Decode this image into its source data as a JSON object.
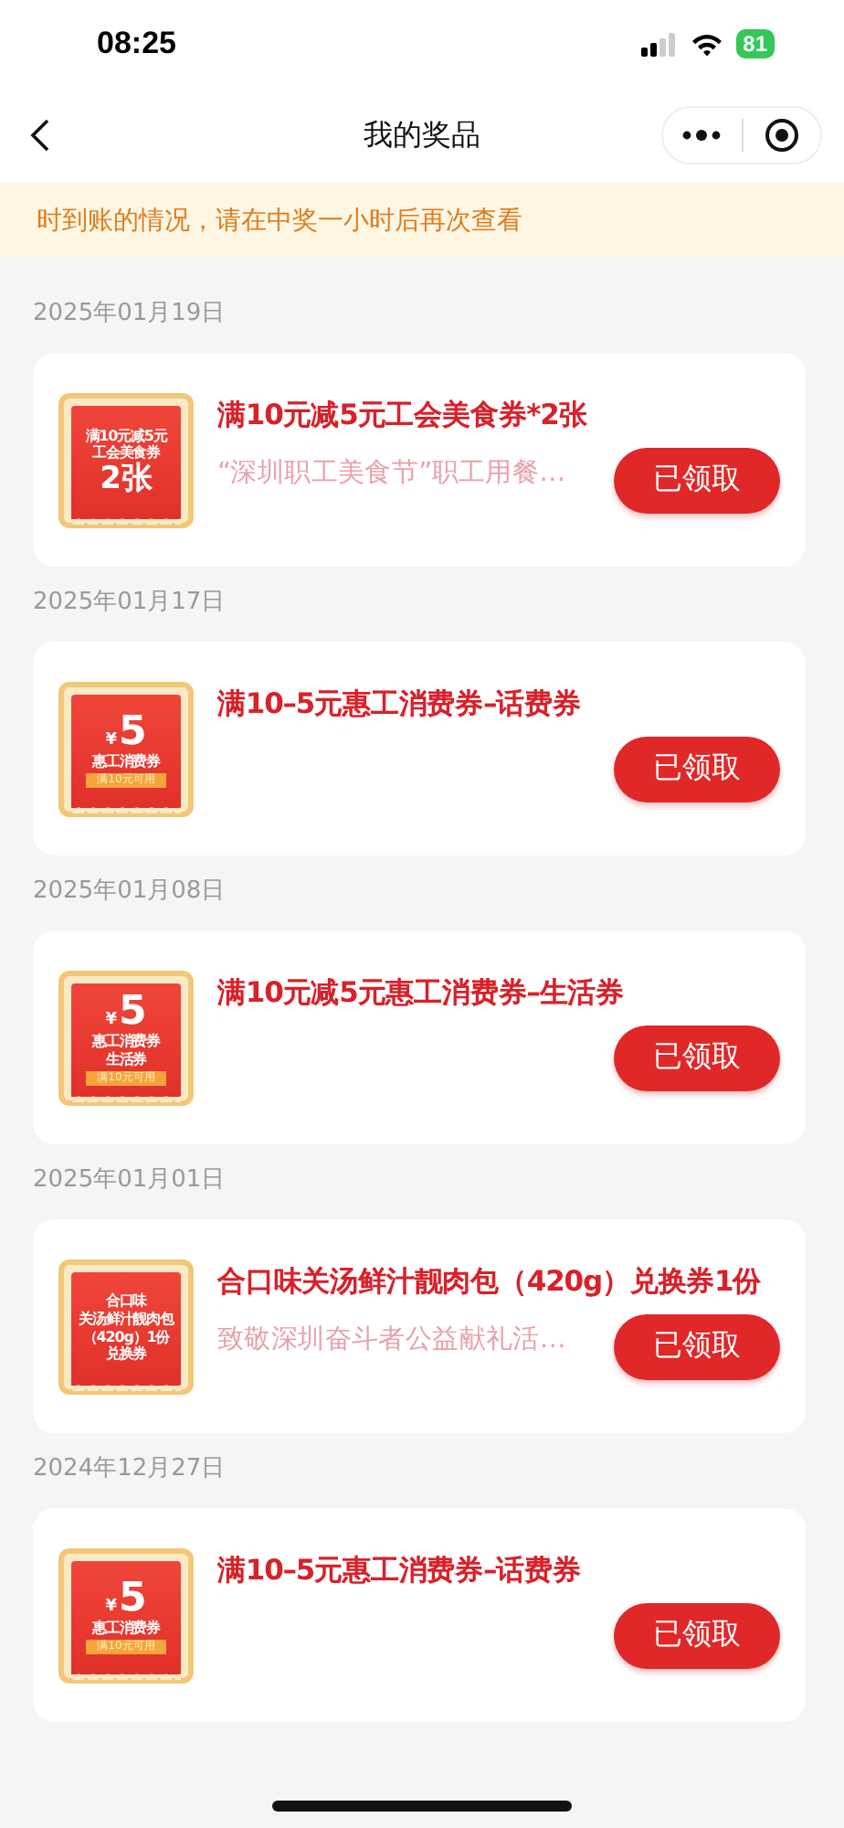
{
  "status_bar": {
    "time": "08:25",
    "battery": "81"
  },
  "nav": {
    "title": "我的奖品"
  },
  "notice": "时到账的情况，请在中奖一小时后再次查看",
  "groups": [
    {
      "date": "2025年01月19日",
      "prize": {
        "thumb": [
          {
            "kind": "small",
            "text": "满10元减5元"
          },
          {
            "kind": "small",
            "text": "工会美食券"
          },
          {
            "kind": "large",
            "text": "2张"
          }
        ],
        "title": "满10元减5元工会美食券*2张",
        "subtitle": "“深圳职工美食节”职工用餐…",
        "button": "已领取"
      }
    },
    {
      "date": "2025年01月17日",
      "prize": {
        "thumb": [
          {
            "kind": "price",
            "currency": "¥",
            "text": "5"
          },
          {
            "kind": "small",
            "text": "惠工消费券"
          },
          {
            "kind": "tag",
            "text": "满10元可用"
          }
        ],
        "title": "满10–5元惠工消费券–话费券",
        "button": "已领取"
      }
    },
    {
      "date": "2025年01月08日",
      "prize": {
        "thumb": [
          {
            "kind": "price",
            "currency": "¥",
            "text": "5"
          },
          {
            "kind": "small",
            "text": "惠工消费券"
          },
          {
            "kind": "small",
            "text": "生活券"
          },
          {
            "kind": "tag",
            "text": "满10元可用"
          }
        ],
        "title": "满10元减5元惠工消费券–生活券",
        "button": "已领取"
      }
    },
    {
      "date": "2025年01月01日",
      "prize": {
        "thumb": [
          {
            "kind": "small",
            "text": "合口味"
          },
          {
            "kind": "small",
            "text": "关汤鲜汁靓肉包"
          },
          {
            "kind": "small",
            "text": "（420g）1份"
          },
          {
            "kind": "small",
            "text": "兑换券"
          }
        ],
        "title": "合口味关汤鲜汁靓肉包（420g）兑换券1份",
        "subtitle": "致敬深圳奋斗者公益献礼活…",
        "button": "已领取"
      }
    },
    {
      "date": "2024年12月27日",
      "prize": {
        "thumb": [
          {
            "kind": "price",
            "currency": "¥",
            "text": "5"
          },
          {
            "kind": "small",
            "text": "惠工消费券"
          },
          {
            "kind": "tag",
            "text": "满10元可用"
          }
        ],
        "title": "满10–5元惠工消费券–话费券",
        "button": "已领取"
      }
    }
  ]
}
